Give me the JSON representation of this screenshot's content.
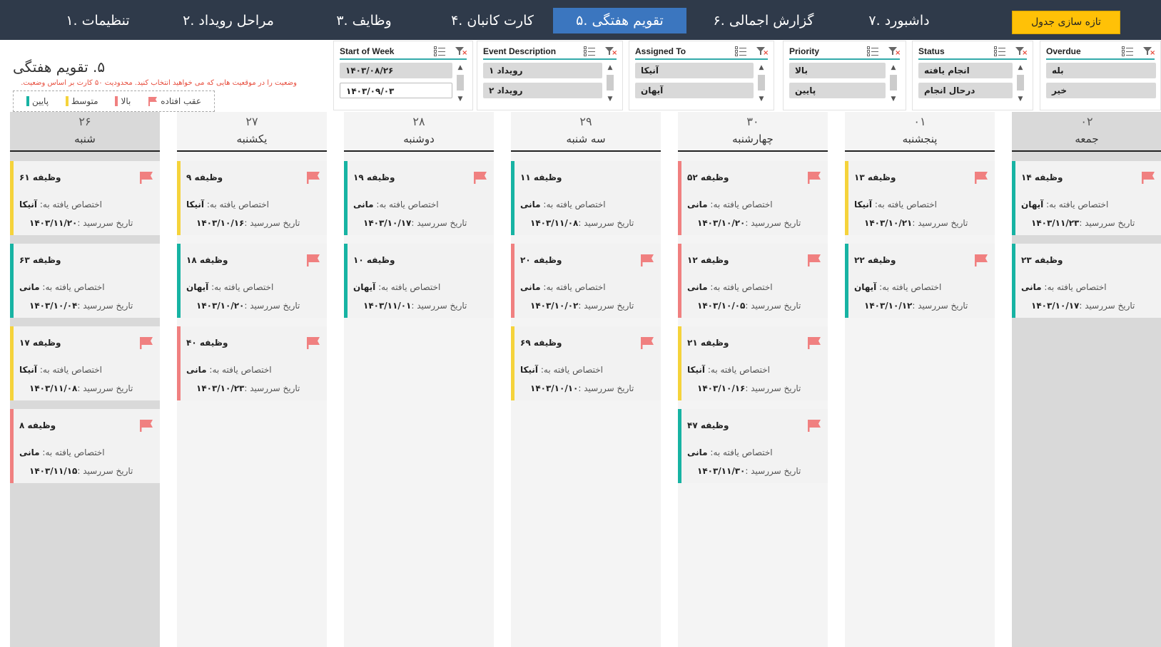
{
  "nav": {
    "tabs": [
      "۱. تنظیمات",
      "۲. مراحل رویداد",
      "۳. وظایف",
      "۴. کارت کانبان",
      "۵. تقویم هفتگی",
      "۶. گزارش اجمالی",
      "۷. داشبورد"
    ],
    "active_index": 4,
    "refresh_label": "تازه سازی جدول"
  },
  "header": {
    "title": "۵. تقویم هفتگی",
    "hint": "وضعیت را در موقعیت هایی که می خواهید انتخاب کنید. محدودیت ۵۰ کارت بر اساس وضعیت.",
    "legend": [
      {
        "label": "عقب افتاده",
        "color": "#f08080",
        "type": "flag-icon"
      },
      {
        "label": "بالا",
        "color": "#f08080"
      },
      {
        "label": "متوسط",
        "color": "#f5d33b"
      },
      {
        "label": "پایین",
        "color": "#17b3a3"
      }
    ]
  },
  "slicers": [
    {
      "title": "Start of Week",
      "items": [
        "۱۴۰۳/۰۸/۲۶",
        "۱۴۰۳/۰۹/۰۳"
      ]
    },
    {
      "title": "Event Description",
      "items": [
        "رویداد ۱",
        "رویداد ۲"
      ]
    },
    {
      "title": "Assigned To",
      "items": [
        "آنیکا",
        "آیهان"
      ]
    },
    {
      "title": "Priority",
      "items": [
        "بالا",
        "پایین"
      ]
    },
    {
      "title": "Status",
      "items": [
        "انجام یافته",
        "درحال انجام"
      ]
    },
    {
      "title": "Overdue",
      "items": [
        "بله",
        "خیر"
      ]
    }
  ],
  "card_labels": {
    "assigned_prefix": "اختصاص یافته به:",
    "due_prefix": "تاریخ سررسید :"
  },
  "colors": {
    "high": "#f08080",
    "medium": "#f5d33b",
    "low": "#17b3a3",
    "flag": "#f08080"
  },
  "days": [
    {
      "num": "۲۶",
      "name": "شنبه",
      "weekend": true,
      "cards": [
        {
          "title": "وظیفه ۶۱",
          "assignee": "آنیکا",
          "due": "۱۴۰۳/۱۱/۲۰",
          "priority": "medium",
          "overdue": true
        },
        {
          "title": "وظیفه ۶۳",
          "assignee": "مانی",
          "due": "۱۴۰۳/۱۰/۰۴",
          "priority": "low",
          "overdue": false
        },
        {
          "title": "وظیفه ۱۷",
          "assignee": "آنیکا",
          "due": "۱۴۰۳/۱۱/۰۸",
          "priority": "medium",
          "overdue": true
        },
        {
          "title": "وظیفه ۸",
          "assignee": "مانی",
          "due": "۱۴۰۳/۱۱/۱۵",
          "priority": "high",
          "overdue": true
        }
      ]
    },
    {
      "num": "۲۷",
      "name": "یکشنبه",
      "weekend": false,
      "cards": [
        {
          "title": "وظیفه ۹",
          "assignee": "آنیکا",
          "due": "۱۴۰۳/۱۰/۱۶",
          "priority": "medium",
          "overdue": true
        },
        {
          "title": "وظیفه ۱۸",
          "assignee": "آیهان",
          "due": "۱۴۰۳/۱۰/۲۰",
          "priority": "low",
          "overdue": true
        },
        {
          "title": "وظیفه ۴۰",
          "assignee": "مانی",
          "due": "۱۴۰۳/۱۰/۲۳",
          "priority": "high",
          "overdue": true
        }
      ]
    },
    {
      "num": "۲۸",
      "name": "دوشنبه",
      "weekend": false,
      "cards": [
        {
          "title": "وظیفه ۱۹",
          "assignee": "مانی",
          "due": "۱۴۰۳/۱۰/۱۷",
          "priority": "low",
          "overdue": true
        },
        {
          "title": "وظیفه ۱۰",
          "assignee": "آیهان",
          "due": "۱۴۰۳/۱۱/۰۱",
          "priority": "low",
          "overdue": false
        }
      ]
    },
    {
      "num": "۲۹",
      "name": "سه شنبه",
      "weekend": false,
      "cards": [
        {
          "title": "وظیفه ۱۱",
          "assignee": "مانی",
          "due": "۱۴۰۳/۱۱/۰۸",
          "priority": "low",
          "overdue": false
        },
        {
          "title": "وظیفه ۲۰",
          "assignee": "مانی",
          "due": "۱۴۰۳/۱۰/۰۲",
          "priority": "high",
          "overdue": true
        },
        {
          "title": "وظیفه ۶۹",
          "assignee": "آنیکا",
          "due": "۱۴۰۳/۱۰/۱۰",
          "priority": "medium",
          "overdue": true
        }
      ]
    },
    {
      "num": "۳۰",
      "name": "چهارشنبه",
      "weekend": false,
      "cards": [
        {
          "title": "وظیفه ۵۲",
          "assignee": "مانی",
          "due": "۱۴۰۳/۱۰/۲۰",
          "priority": "high",
          "overdue": true
        },
        {
          "title": "وظیفه ۱۲",
          "assignee": "مانی",
          "due": "۱۴۰۳/۱۰/۰۵",
          "priority": "high",
          "overdue": true
        },
        {
          "title": "وظیفه ۲۱",
          "assignee": "آنیکا",
          "due": "۱۴۰۳/۱۰/۱۶",
          "priority": "medium",
          "overdue": true
        },
        {
          "title": "وظیفه ۴۷",
          "assignee": "مانی",
          "due": "۱۴۰۳/۱۱/۳۰",
          "priority": "low",
          "overdue": true
        }
      ]
    },
    {
      "num": "۰۱",
      "name": "پنجشنبه",
      "weekend": false,
      "cards": [
        {
          "title": "وظیفه ۱۳",
          "assignee": "آنیکا",
          "due": "۱۴۰۳/۱۰/۲۱",
          "priority": "medium",
          "overdue": true
        },
        {
          "title": "وظیفه ۲۲",
          "assignee": "آیهان",
          "due": "۱۴۰۳/۱۰/۱۲",
          "priority": "low",
          "overdue": true
        }
      ]
    },
    {
      "num": "۰۲",
      "name": "جمعه",
      "weekend": true,
      "cards": [
        {
          "title": "وظیفه ۱۴",
          "assignee": "آیهان",
          "due": "۱۴۰۳/۱۱/۲۳",
          "priority": "low",
          "overdue": true
        },
        {
          "title": "وظیفه ۲۳",
          "assignee": "مانی",
          "due": "۱۴۰۳/۱۰/۱۷",
          "priority": "low",
          "overdue": false
        }
      ]
    }
  ]
}
